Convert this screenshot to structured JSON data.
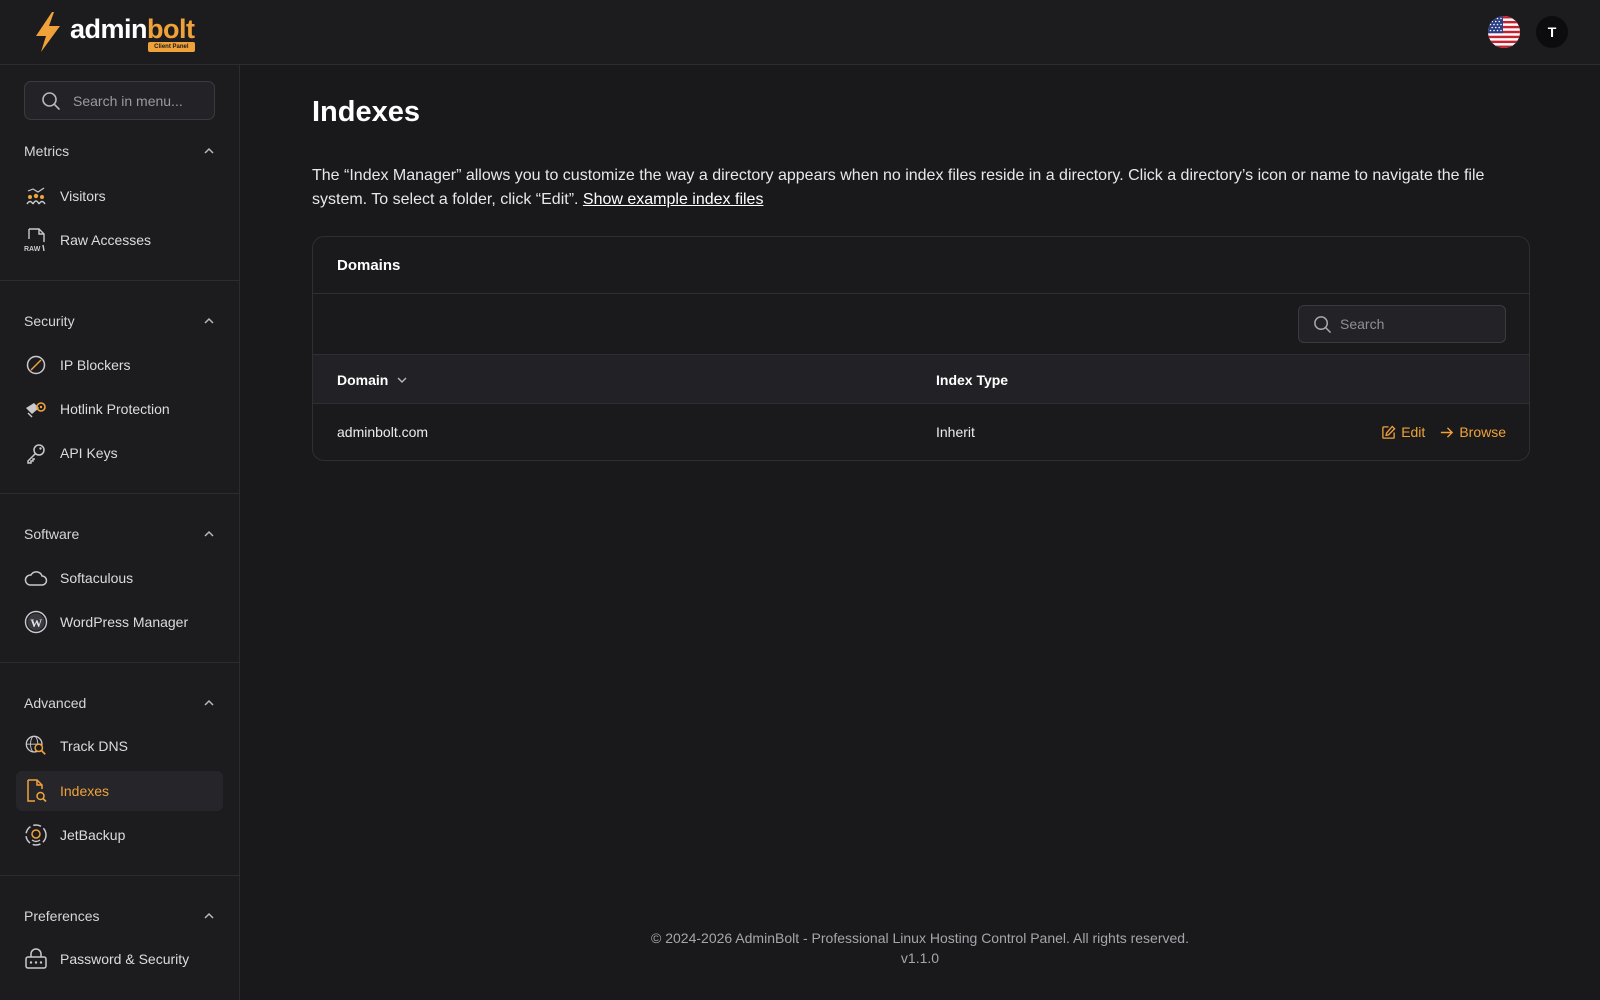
{
  "brand": {
    "name_part1": "admin",
    "name_part2": "bolt",
    "badge": "Client Panel",
    "accent": "#f0a23a"
  },
  "header": {
    "avatar_initial": "T",
    "language_flag": "us-flag-icon"
  },
  "sidebar": {
    "search_placeholder": "Search in menu...",
    "sections": [
      {
        "title": "Metrics",
        "items": [
          {
            "label": "Visitors",
            "icon": "visitors-icon"
          },
          {
            "label": "Raw Accesses",
            "icon": "raw-file-icon"
          }
        ]
      },
      {
        "title": "Security",
        "items": [
          {
            "label": "IP Blockers",
            "icon": "block-icon"
          },
          {
            "label": "Hotlink Protection",
            "icon": "hotlink-icon"
          },
          {
            "label": "API Keys",
            "icon": "key-icon"
          }
        ]
      },
      {
        "title": "Software",
        "items": [
          {
            "label": "Softaculous",
            "icon": "cloud-icon"
          },
          {
            "label": "WordPress Manager",
            "icon": "wordpress-icon"
          }
        ]
      },
      {
        "title": "Advanced",
        "items": [
          {
            "label": "Track DNS",
            "icon": "track-dns-icon"
          },
          {
            "label": "Indexes",
            "icon": "file-search-icon",
            "active": true
          },
          {
            "label": "JetBackup",
            "icon": "jetbackup-icon"
          }
        ]
      },
      {
        "title": "Preferences",
        "items": [
          {
            "label": "Password & Security",
            "icon": "password-icon"
          }
        ]
      }
    ]
  },
  "main": {
    "title": "Indexes",
    "intro_text": "The “Index Manager” allows you to customize the way a directory appears when no index files reside in a directory. Click a directory’s icon or name to navigate the file system. To select a folder, click “Edit”. ",
    "intro_link": "Show example index files",
    "card_title": "Domains",
    "table_search_placeholder": "Search",
    "columns": {
      "domain": "Domain",
      "index_type": "Index Type"
    },
    "rows": [
      {
        "domain": "adminbolt.com",
        "index_type": "Inherit",
        "edit_label": "Edit",
        "browse_label": "Browse"
      }
    ]
  },
  "footer": {
    "copyright": "© 2024-2026 AdminBolt - Professional Linux Hosting Control Panel. All rights reserved.",
    "version": "v1.1.0"
  }
}
